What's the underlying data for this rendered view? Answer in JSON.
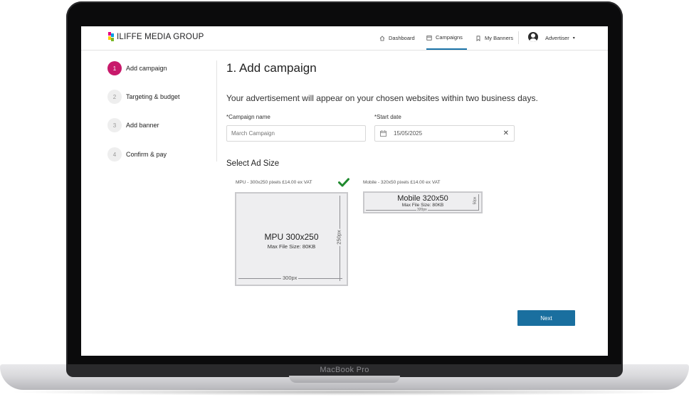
{
  "brand": {
    "logo_text": "ILIFFE MEDIA GROUP",
    "laptop_label": "MacBook Pro"
  },
  "nav": {
    "items": [
      {
        "label": "Dashboard",
        "icon": "home-icon",
        "active": false
      },
      {
        "label": "Campaigns",
        "icon": "calendar-icon",
        "active": true
      },
      {
        "label": "My Banners",
        "icon": "bookmark-icon",
        "active": false
      }
    ],
    "user_menu_label": "Advertiser",
    "user_icon": "user-avatar-icon"
  },
  "steps": [
    {
      "number": "1",
      "label": "Add campaign",
      "active": true
    },
    {
      "number": "2",
      "label": "Targeting & budget",
      "active": false
    },
    {
      "number": "3",
      "label": "Add banner",
      "active": false
    },
    {
      "number": "4",
      "label": "Confirm & pay",
      "active": false
    }
  ],
  "main": {
    "title": "1. Add campaign",
    "intro": "Your advertisement will appear on your chosen websites within two business days.",
    "campaign_name": {
      "label": "*Campaign name",
      "placeholder": "March Campaign",
      "value": ""
    },
    "start_date": {
      "label": "*Start date",
      "value": "15/05/2025"
    },
    "ad_size_title": "Select Ad Size",
    "ad_sizes": [
      {
        "caption": "MPU - 300x250 pixels £14.00 ex VAT",
        "name": "MPU 300x250",
        "max_file": "Max File Size: 80KB",
        "width_label": "300px",
        "height_label": "250px",
        "selected": true
      },
      {
        "caption": "Mobile - 320x50 pixels £14.00 ex VAT",
        "name": "Mobile 320x50",
        "max_file": "Max File Size: 80KB",
        "width_label": "320px",
        "height_label": "50px",
        "selected": false
      }
    ],
    "next_label": "Next"
  },
  "colors": {
    "accent": "#c8196b",
    "primary": "#1a6f9f",
    "check": "#1f8a2e"
  }
}
